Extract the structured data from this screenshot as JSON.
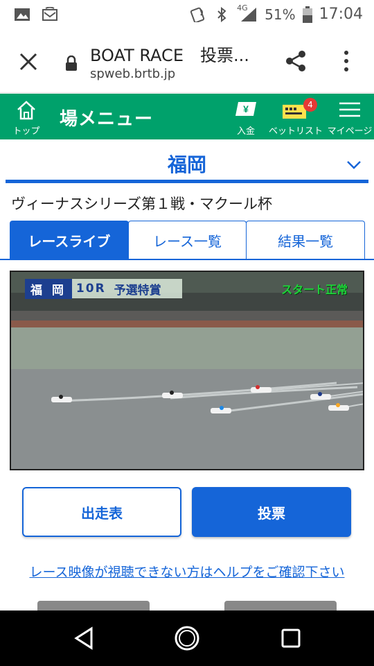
{
  "status_bar": {
    "network": "4G",
    "battery": "51%",
    "time": "17:04",
    "icons": [
      "image-icon",
      "sim-icon",
      "nfc-icon",
      "bluetooth-icon",
      "signal-icon",
      "battery-icon"
    ]
  },
  "browser": {
    "title": "BOAT RACE　投票...",
    "url": "spweb.brtb.jp"
  },
  "site_header": {
    "home_label": "トップ",
    "menu_title": "場メニュー",
    "deposit_label": "入金",
    "deposit_glyph": "¥",
    "betlist_label": "ベットリスト",
    "betlist_count": "4",
    "mypage_label": "マイページ",
    "color": "#00a16b"
  },
  "venue": {
    "name": "福岡"
  },
  "series_title": "ヴィーナスシリーズ第１戦・マクール杯",
  "tabs": [
    {
      "label": "レースライブ",
      "active": true
    },
    {
      "label": "レース一覧",
      "active": false
    },
    {
      "label": "結果一覧",
      "active": false
    }
  ],
  "video": {
    "venue_overlay": "福 岡",
    "race_no": "10R",
    "race_name": "予選特賞",
    "start_status": "スタート正常"
  },
  "buttons": {
    "entry": "出走表",
    "vote": "投票"
  },
  "help_link": "レース映像が視聴できない方はヘルプをご確認下さい",
  "accent_color": "#1565d8"
}
